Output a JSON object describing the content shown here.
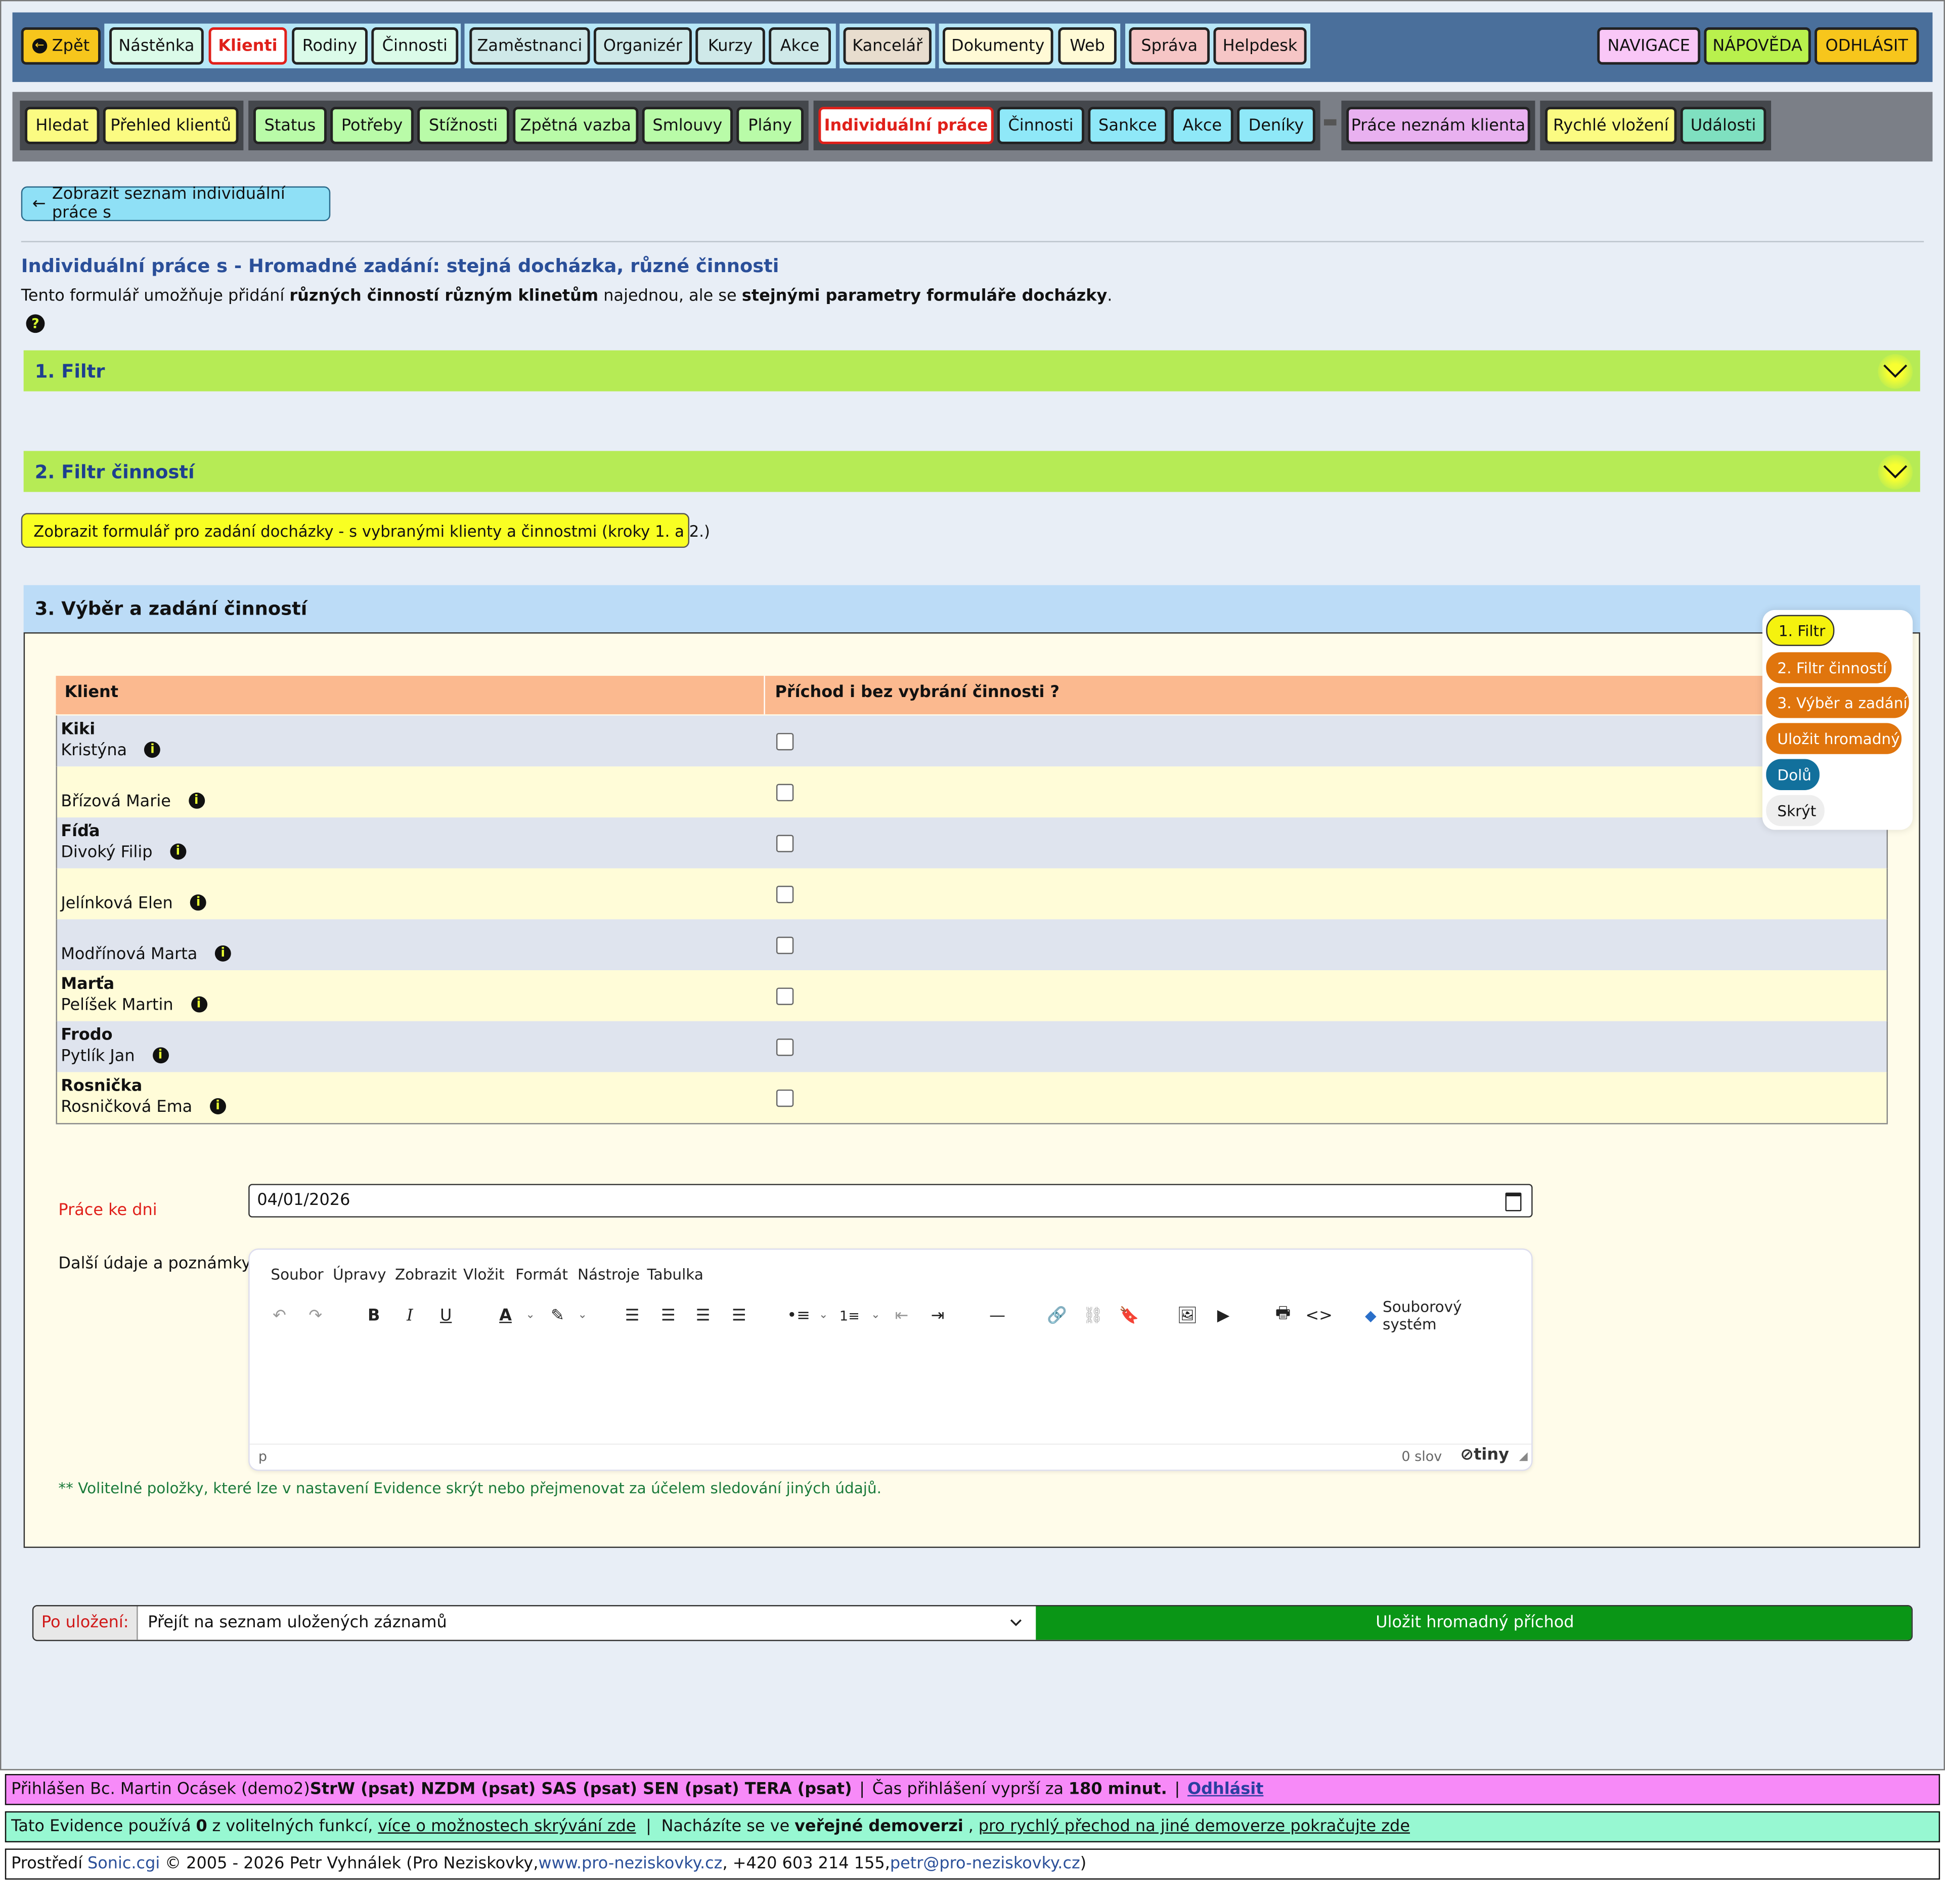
{
  "topnav": {
    "back": "Zpět",
    "items": [
      "Nástěnka",
      "Klienti",
      "Rodiny",
      "Činnosti",
      "Zaměstnanci",
      "Organizér",
      "Kurzy",
      "Akce",
      "Kancelář",
      "Dokumenty",
      "Web",
      "Správa",
      "Helpdesk"
    ],
    "right": [
      "NAVIGACE",
      "NÁPOVĚDA",
      "ODHLÁSIT"
    ]
  },
  "subnav": {
    "items": [
      "Hledat",
      "Přehled klientů",
      "Status",
      "Potřeby",
      "Stížnosti",
      "Zpětná vazba",
      "Smlouvy",
      "Plány",
      "Individuální práce",
      "Činnosti",
      "Sankce",
      "Akce",
      "Deníky",
      "Práce neznám klienta",
      "Rychlé vložení",
      "Události"
    ]
  },
  "list_button": "Zobrazit seznam individuální práce s",
  "page_title": "Individuální práce s - Hromadné zadání: stejná docházka, různé činnosti",
  "description": {
    "p1": "Tento formulář umožňuje přidání ",
    "b1": "různých činností různým klinetům",
    "p2": " najednou, ale se ",
    "b2": "stejnými parametry formuláře docházky",
    "p3": "."
  },
  "sections": {
    "filter": "1. Filtr",
    "activity_filter": "2. Filtr činností",
    "show_form": "Zobrazit formulář pro zadání docházky - s vybranými klienty a činnostmi (kroky 1. a 2.)",
    "selection": "3. Výběr a zadání činností"
  },
  "table": {
    "headers": [
      "Klient",
      "Příchod i bez vybrání činnosti ?"
    ],
    "rows": [
      {
        "nick": "Kiki",
        "name": "Kristýna"
      },
      {
        "nick": "",
        "name": "Břízová Marie"
      },
      {
        "nick": "Fíďa",
        "name": "Divoký Filip"
      },
      {
        "nick": "",
        "name": "Jelínková Elen"
      },
      {
        "nick": "",
        "name": "Modřínová Marta"
      },
      {
        "nick": "Marťa",
        "name": "Pelíšek Martin"
      },
      {
        "nick": "Frodo",
        "name": "Pytlík Jan"
      },
      {
        "nick": "Rosnička",
        "name": "Rosničková Ema"
      }
    ]
  },
  "form": {
    "date_label": "Práce ke dni",
    "date_value": "04/01/2026",
    "notes_label": "Další údaje a poznámky:",
    "editor_menu": [
      "Soubor",
      "Úpravy",
      "Zobrazit",
      "Vložit",
      "Formát",
      "Nástroje",
      "Tabulka"
    ],
    "file_system": "Souborový systém",
    "status_p": "p",
    "word_count": "0 slov",
    "brand": "tiny",
    "optional_note": "** Volitelné položky, které lze v nastavení Evidence skrýt nebo přejmenovat za účelem sledování jiných údajů."
  },
  "side_menu": [
    "1. Filtr",
    "2. Filtr činností",
    "3. Výběr a zadání",
    "Uložit hromadný",
    "Dolů",
    "Skrýt"
  ],
  "save": {
    "after_label": "Po uložení:",
    "after_value": "Přejít na seznam uložených záznamů",
    "button": "Uložit hromadný příchod"
  },
  "footer": {
    "login_prefix": "Přihlášen Bc. Martin Ocásek (demo2) ",
    "roles": "StrW (psat) NZDM (psat) SAS (psat) SEN (psat) TERA (psat)",
    "session": "Čas přihlášení vyprší za ",
    "minutes": "180 minut.",
    "logout": "Odhlásit",
    "evidence_prefix": "Tato Evidence používá ",
    "count": "0",
    "evidence_mid": " z volitelných funkcí, ",
    "evidence_link": "více o možnostech skrývání zde",
    "demo_prefix": "Nacházíte se ve ",
    "demo_bold": "veřejné demoverzi",
    "demo_link": "pro rychlý přechod na jiné demoverze pokračujte zde",
    "copyright_prefix": "Prostředí ",
    "sonic": "Sonic.cgi",
    "copyright_mid": " © 2005 - 2026 Petr Vyhnálek (Pro Neziskovky, ",
    "web": "www.pro-neziskovky.cz",
    "phone": ", +420 603 214 155, ",
    "email": "petr@pro-neziskovky.cz",
    "copyright_end": ")"
  },
  "colors": {
    "accent_blue": "#4a6f9b",
    "section_green": "#b6eb55",
    "save_green": "#0a9616",
    "footer_pink": "#f78af8",
    "footer_mint": "#97f8d2"
  }
}
